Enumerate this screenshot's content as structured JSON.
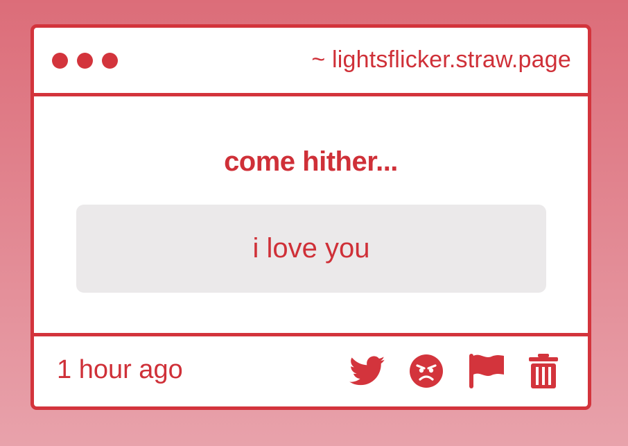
{
  "window": {
    "url": "~ lightsflicker.straw.page"
  },
  "post": {
    "prompt": "come hither...",
    "answer": "i love you",
    "timestamp": "1 hour ago"
  },
  "actions": [
    {
      "name": "twitter-share",
      "icon": "twitter-bird-icon"
    },
    {
      "name": "angry-react",
      "icon": "angry-face-icon"
    },
    {
      "name": "report",
      "icon": "flag-icon"
    },
    {
      "name": "delete",
      "icon": "trash-icon"
    }
  ],
  "colors": {
    "accent": "#d3343c",
    "background_top": "#dc6d79",
    "background_bottom": "#e8a2ab",
    "answer_box": "#ebe9ea",
    "window": "#ffffff"
  }
}
